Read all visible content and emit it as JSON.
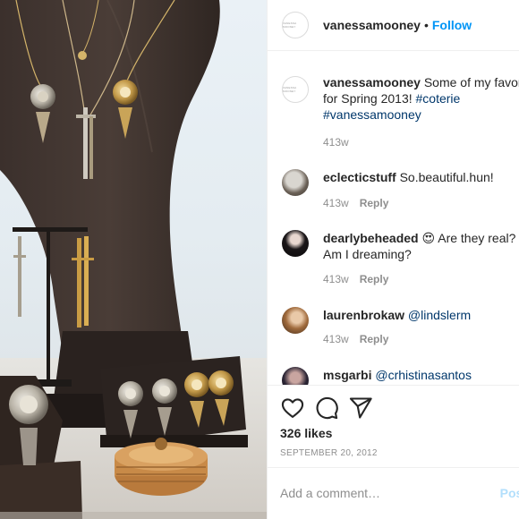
{
  "post": {
    "username": "vanessamooney",
    "follow_label": "Follow",
    "separator": "•",
    "avatar_brand": "VANESSA MOONEY"
  },
  "caption": {
    "username": "vanessamooney",
    "text": "Some of my favor",
    "text2": "for Spring 2013!",
    "tag1": "#coterie",
    "tag2": "#vanessamooney",
    "time": "413w"
  },
  "comments": [
    {
      "username": "eclecticstuff",
      "text": "So.beautiful.hun!",
      "time": "413w",
      "reply": "Reply"
    },
    {
      "username": "dearlybeheaded",
      "emoji": "😍",
      "text": "Are they real?",
      "text2": "Am I dreaming?",
      "time": "413w",
      "reply": "Reply"
    },
    {
      "username": "laurenbrokaw",
      "mention": "@lindslerm",
      "time": "413w",
      "reply": "Reply"
    },
    {
      "username": "msgarbi",
      "mention": "@crhistinasantos"
    }
  ],
  "actions": {
    "likes": "326 likes",
    "date": "SEPTEMBER 20, 2012",
    "like_icon": "heart-icon",
    "comment_icon": "comment-icon",
    "share_icon": "paper-plane-icon"
  },
  "add_comment": {
    "placeholder": "Add a comment…",
    "post_label": "Post"
  },
  "colors": {
    "link": "#0095f6",
    "hashtag": "#00376b",
    "muted": "#8e8e8e",
    "text": "#262626"
  }
}
